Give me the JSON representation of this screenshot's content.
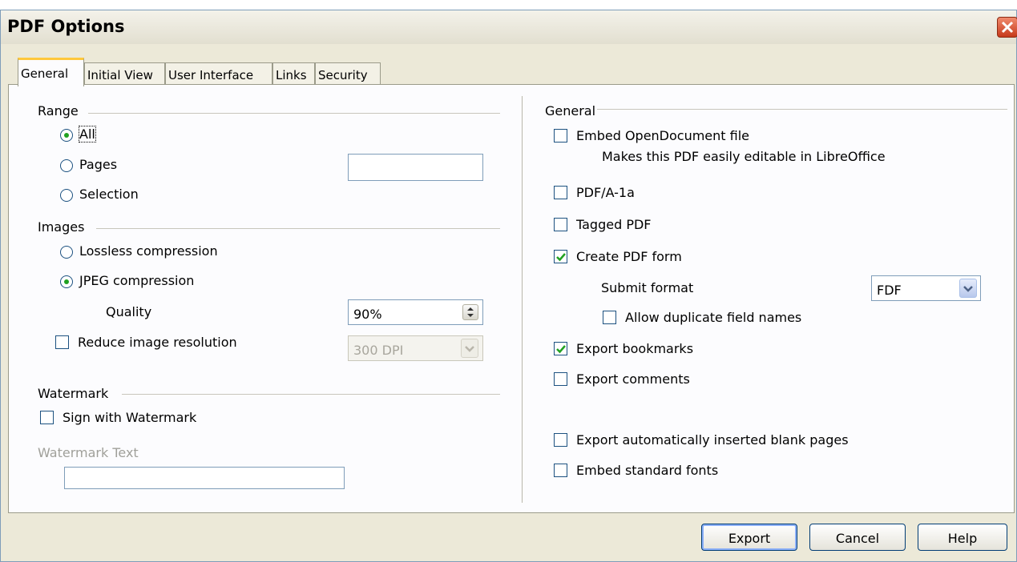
{
  "dialog": {
    "title": "PDF Options"
  },
  "tabs": [
    "General",
    "Initial View",
    "User Interface",
    "Links",
    "Security"
  ],
  "left": {
    "range": {
      "heading": "Range",
      "all": "All",
      "pages": "Pages",
      "pages_value": "",
      "selection": "Selection",
      "selected": "All"
    },
    "images": {
      "heading": "Images",
      "lossless": "Lossless compression",
      "jpeg": "JPEG compression",
      "selected": "JPEG compression",
      "quality_label": "Quality",
      "quality_value": "90%",
      "reduce_label": "Reduce image resolution",
      "reduce_checked": false,
      "resolution_value": "300 DPI"
    },
    "watermark": {
      "heading": "Watermark",
      "sign_label": "Sign with Watermark",
      "sign_checked": false,
      "text_label": "Watermark Text",
      "text_value": ""
    }
  },
  "right": {
    "heading": "General",
    "embed_odf": "Embed OpenDocument file",
    "embed_odf_desc": "Makes this PDF easily editable in LibreOffice",
    "pdfa": "PDF/A-1a",
    "tagged": "Tagged PDF",
    "create_form": "Create PDF form",
    "submit_format_label": "Submit format",
    "submit_format_value": "FDF",
    "allow_dup": "Allow duplicate field names",
    "export_bookmarks": "Export bookmarks",
    "export_comments": "Export comments",
    "export_blank": "Export automatically inserted blank pages",
    "embed_fonts": "Embed standard fonts",
    "checked": [
      "Create PDF form",
      "Export bookmarks"
    ]
  },
  "buttons": {
    "export": "Export",
    "cancel": "Cancel",
    "help": "Help"
  }
}
